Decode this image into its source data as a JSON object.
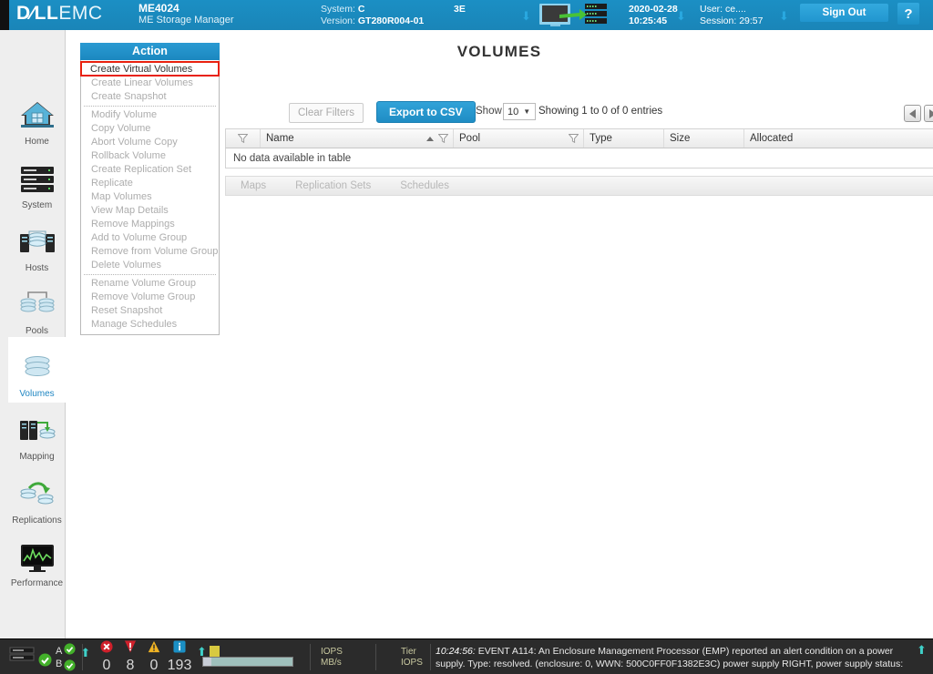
{
  "header": {
    "brand_dell": "D⁄LL",
    "brand_emc": "EMC",
    "product_model": "ME4024",
    "product_name": "ME Storage Manager",
    "system_label": "System:",
    "system_value": "C",
    "system_value_tail": "3E",
    "version_label": "Version:",
    "version_value": "GT280R004-01",
    "date": "2020-02-28",
    "time": "10:25:45",
    "user_label": "User:",
    "user_value": "ce....",
    "session_label": "Session:",
    "session_value": "29:57",
    "sign_out": "Sign Out",
    "help": "?"
  },
  "sidebar": {
    "items": [
      {
        "label": "Home",
        "icon": "home-icon",
        "active": false
      },
      {
        "label": "System",
        "icon": "rack-icon",
        "active": false
      },
      {
        "label": "Hosts",
        "icon": "hosts-icon",
        "active": false
      },
      {
        "label": "Pools",
        "icon": "pools-icon",
        "active": false
      },
      {
        "label": "Volumes",
        "icon": "volumes-icon",
        "active": true
      },
      {
        "label": "Mapping",
        "icon": "mapping-icon",
        "active": false
      },
      {
        "label": "Replications",
        "icon": "replications-icon",
        "active": false
      },
      {
        "label": "Performance",
        "icon": "performance-icon",
        "active": false
      }
    ]
  },
  "main": {
    "title": "VOLUMES",
    "toolbar": {
      "clear_filters": "Clear Filters",
      "export_csv": "Export to CSV",
      "show_label": "Show",
      "show_value": "10",
      "showing_text": "Showing 1 to 0 of 0 entries"
    },
    "table": {
      "columns": [
        "Name",
        "Pool",
        "Type",
        "Size",
        "Allocated"
      ],
      "empty_text": "No data available in table",
      "sort_column": "Name",
      "sort_direction": "asc"
    },
    "tabs": [
      {
        "label": "Maps",
        "active": false
      },
      {
        "label": "Replication Sets",
        "active": false
      },
      {
        "label": "Schedules",
        "active": false
      }
    ]
  },
  "action_menu": {
    "header": "Action",
    "items": [
      {
        "label": "Create Virtual Volumes",
        "enabled": true,
        "highlighted": true
      },
      {
        "label": "Create Linear Volumes",
        "enabled": false,
        "highlighted": false
      },
      {
        "label": "Create Snapshot",
        "enabled": false,
        "highlighted": false
      },
      {
        "label": "__separator__",
        "enabled": false,
        "highlighted": false
      },
      {
        "label": "Modify Volume",
        "enabled": false,
        "highlighted": false
      },
      {
        "label": "Copy Volume",
        "enabled": false,
        "highlighted": false
      },
      {
        "label": "Abort Volume Copy",
        "enabled": false,
        "highlighted": false
      },
      {
        "label": "Rollback Volume",
        "enabled": false,
        "highlighted": false
      },
      {
        "label": "Create Replication Set",
        "enabled": false,
        "highlighted": false
      },
      {
        "label": "Replicate",
        "enabled": false,
        "highlighted": false
      },
      {
        "label": "Map Volumes",
        "enabled": false,
        "highlighted": false
      },
      {
        "label": "View Map Details",
        "enabled": false,
        "highlighted": false
      },
      {
        "label": "Remove Mappings",
        "enabled": false,
        "highlighted": false
      },
      {
        "label": "Add to Volume Group",
        "enabled": false,
        "highlighted": false
      },
      {
        "label": "Remove from Volume Group",
        "enabled": false,
        "highlighted": false
      },
      {
        "label": "Delete Volumes",
        "enabled": false,
        "highlighted": false
      },
      {
        "label": "__separator__",
        "enabled": false,
        "highlighted": false
      },
      {
        "label": "Rename Volume Group",
        "enabled": false,
        "highlighted": false
      },
      {
        "label": "Remove Volume Group",
        "enabled": false,
        "highlighted": false
      },
      {
        "label": "Reset Snapshot",
        "enabled": false,
        "highlighted": false
      },
      {
        "label": "Manage Schedules",
        "enabled": false,
        "highlighted": false
      }
    ]
  },
  "statusbar": {
    "controller_a": "A",
    "controller_b": "B",
    "counts": [
      {
        "icon": "error-icon",
        "value": "0"
      },
      {
        "icon": "critical-icon",
        "value": "8"
      },
      {
        "icon": "warning-icon",
        "value": "0"
      },
      {
        "icon": "info-icon",
        "value": "193"
      }
    ],
    "iops_label": "IOPS",
    "mbs_label": "MB/s",
    "tier_label": "Tier",
    "tier_iops_label": "IOPS",
    "event_time": "10:24:56:",
    "event_line1": "EVENT A114: An Enclosure Management Processor (EMP) reported an alert condition on a power",
    "event_line2": "supply. Type: resolved. (enclosure: 0, WWN: 500C0FF0F1382E3C) power supply RIGHT, power supply status:"
  },
  "colors": {
    "brand_blue": "#1b8fc4",
    "accent_blue": "#2196cf",
    "highlight_red": "#e8210f",
    "active_text": "#1f86c2",
    "status_bg": "#2b2b2b"
  }
}
